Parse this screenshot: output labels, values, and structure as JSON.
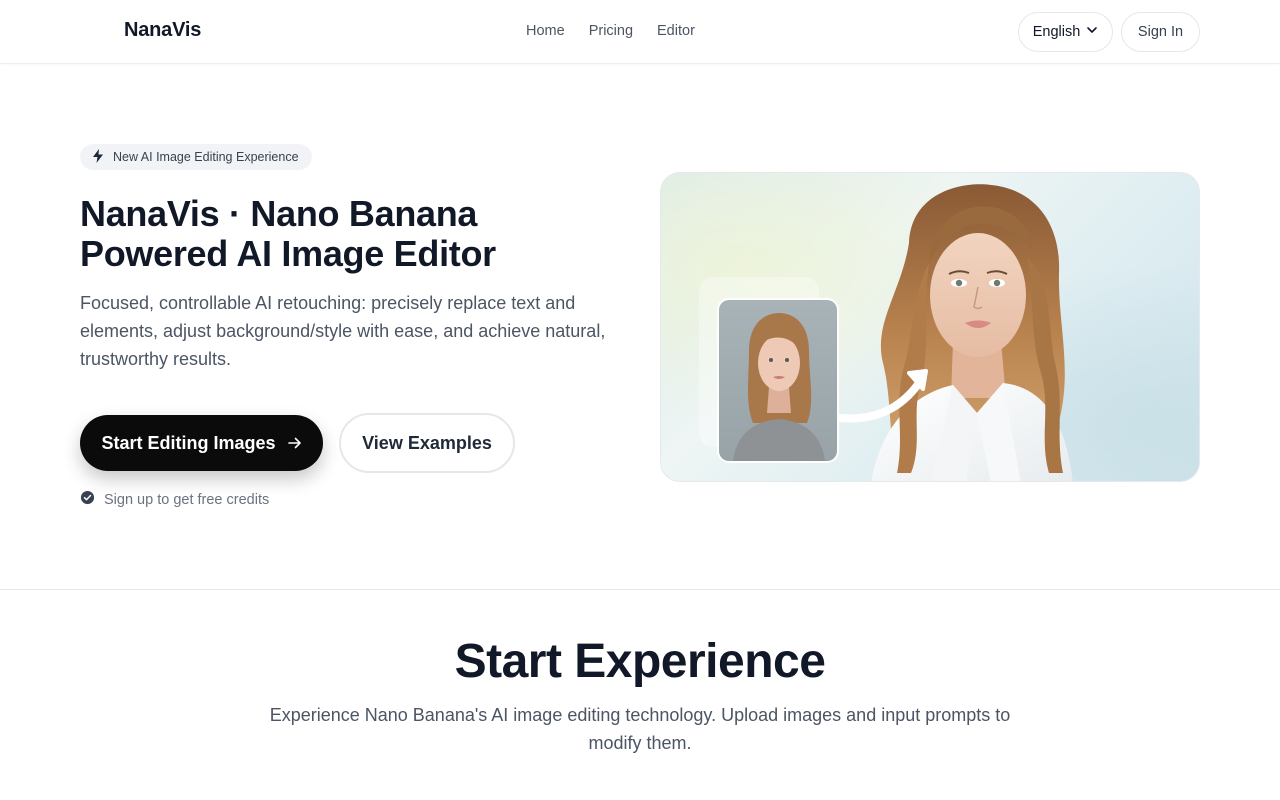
{
  "header": {
    "logo": "NanaVis",
    "nav": [
      {
        "label": "Home"
      },
      {
        "label": "Pricing"
      },
      {
        "label": "Editor"
      }
    ],
    "language": "English",
    "sign_in": "Sign In"
  },
  "hero": {
    "badge": "New AI Image Editing Experience",
    "title_line1": "NanaVis · Nano Banana",
    "title_line2": "Powered AI Image Editor",
    "description": "Focused, controllable AI retouching: precisely replace text and elements, adjust background/style with ease, and achieve natural, trustworthy results.",
    "primary_button": "Start Editing Images",
    "secondary_button": "View Examples",
    "note": "Sign up to get free credits"
  },
  "section": {
    "title": "Start Experience",
    "description": "Experience Nano Banana's AI image editing technology. Upload images and input prompts to modify them."
  },
  "icons": {
    "badge_icon": "lightning-icon",
    "lang_icon": "chevron-down-icon",
    "button_icon": "arrow-right-icon",
    "note_icon": "check-circle-icon"
  }
}
